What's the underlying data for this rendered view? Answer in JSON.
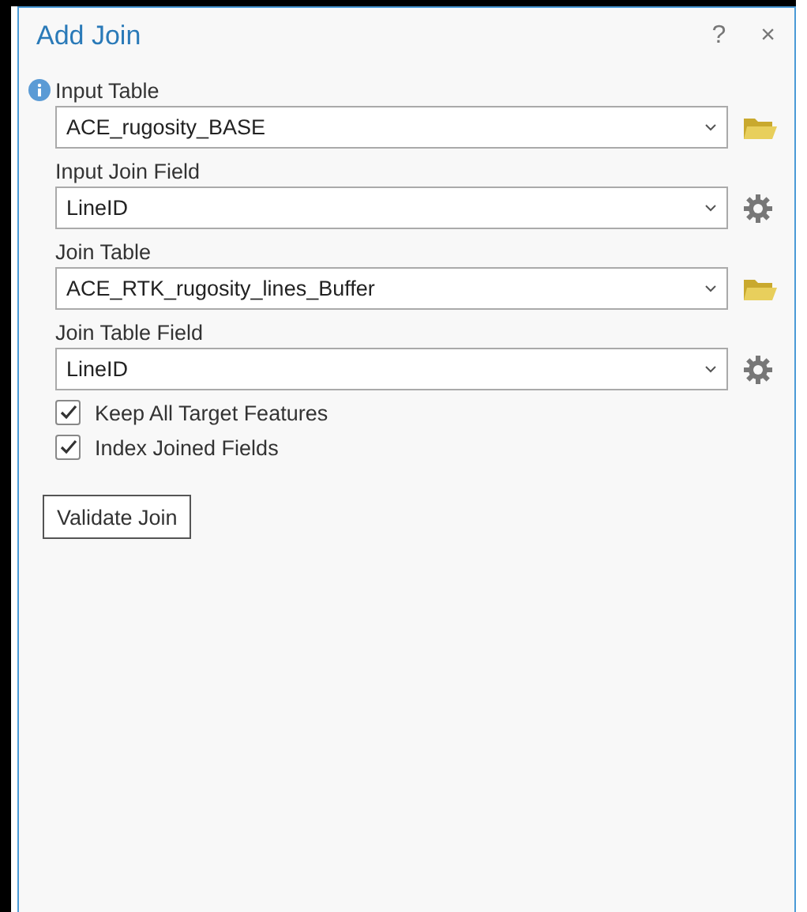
{
  "window": {
    "title": "Add Join",
    "help": "?",
    "close": "×"
  },
  "fields": [
    {
      "label": "Input Table",
      "value": "ACE_rugosity_BASE",
      "kind": "browse",
      "info": true
    },
    {
      "label": "Input Join Field",
      "value": "LineID",
      "kind": "settings",
      "info": false
    },
    {
      "label": "Join Table",
      "value": "ACE_RTK_rugosity_lines_Buffer",
      "kind": "browse",
      "info": false
    },
    {
      "label": "Join Table Field",
      "value": "LineID",
      "kind": "settings",
      "info": false
    }
  ],
  "options": [
    {
      "label": "Keep All Target Features",
      "checked": true
    },
    {
      "label": "Index Joined Fields",
      "checked": true
    }
  ],
  "buttons": [
    "Validate Join"
  ]
}
